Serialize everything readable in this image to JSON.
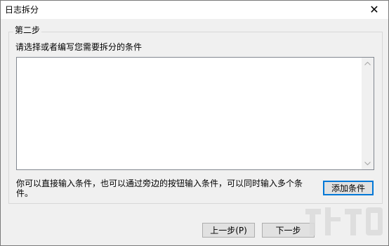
{
  "window": {
    "title": "日志拆分",
    "close_glyph": "✕"
  },
  "group": {
    "label": "第二步"
  },
  "instruction": "请选择或者编写您需要拆分的条件",
  "condition_input": {
    "value": ""
  },
  "hint": "你可以直接输入条件，也可以通过旁边的按钮输入条件，可以同时输入多个条件。",
  "buttons": {
    "add": "添加条件",
    "prev": "上一步(P)",
    "next": "下一步"
  },
  "icons": {
    "close": "close-icon",
    "scroll_up": "chevron-up-icon",
    "scroll_down": "chevron-down-icon"
  },
  "colors": {
    "accent": "#0078d7",
    "border": "#828790",
    "background": "#f0f0f0"
  }
}
